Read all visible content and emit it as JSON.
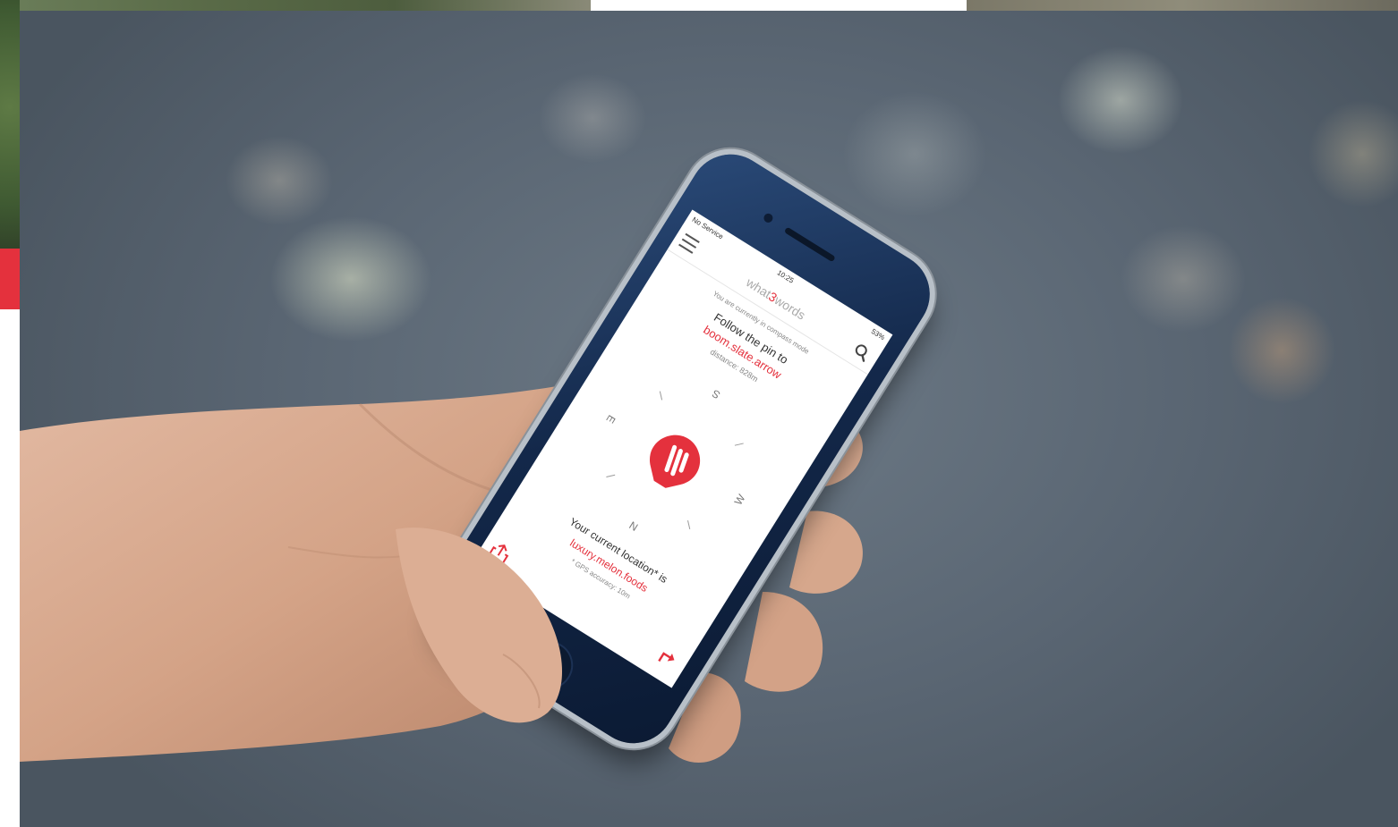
{
  "status_bar": {
    "carrier": "No Service",
    "time": "10:25",
    "battery": "53%"
  },
  "app": {
    "logo_prefix": "what",
    "logo_accent": "3",
    "logo_suffix": "words",
    "accent_color": "#e4313d"
  },
  "icons": {
    "menu": "hamburger-menu-icon",
    "search": "search-icon",
    "share": "share-icon",
    "directions": "directions-icon",
    "pin": "what3words-pin-icon"
  },
  "navigation": {
    "mode_text": "You are currently in compass mode",
    "follow_text": "Follow the pin to",
    "target_words": "boom.slate.arrow",
    "distance": "distance: 828m"
  },
  "compass": {
    "north": "N",
    "south": "S",
    "east": "E",
    "west": "W"
  },
  "current_location": {
    "label": "Your current location* is",
    "words": "luxury.melon.foods",
    "accuracy": "* GPS accuracy: 10m"
  }
}
